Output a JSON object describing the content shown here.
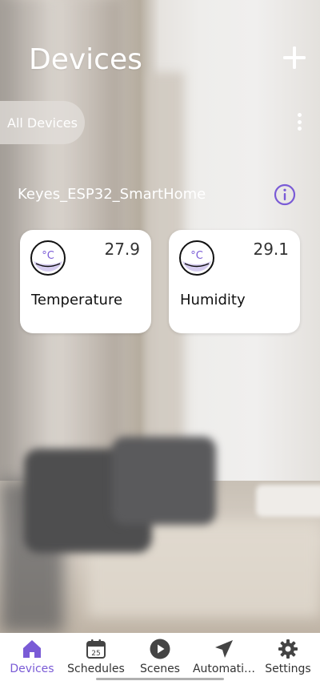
{
  "header": {
    "title": "Devices",
    "add_icon": "plus-icon"
  },
  "filter": {
    "chip_label": "All Devices",
    "more_icon": "more-vertical-icon"
  },
  "group": {
    "name": "Keyes_ESP32_SmartHome",
    "info_icon": "info-icon"
  },
  "cards": [
    {
      "label": "Temperature",
      "value": "27.9",
      "icon": "thermometer-celsius-icon"
    },
    {
      "label": "Humidity",
      "value": "29.1",
      "icon": "thermometer-celsius-icon"
    }
  ],
  "bottom_nav": {
    "items": [
      {
        "label": "Devices",
        "icon": "home-icon",
        "active": true
      },
      {
        "label": "Schedules",
        "icon": "calendar-icon",
        "badge": "25"
      },
      {
        "label": "Scenes",
        "icon": "play-icon"
      },
      {
        "label": "Automati…",
        "icon": "send-icon"
      },
      {
        "label": "Settings",
        "icon": "gear-icon"
      }
    ]
  },
  "colors": {
    "accent": "#7a5bd6",
    "card_bg": "#ffffff",
    "icon_purple_light": "#d6cdf0"
  }
}
